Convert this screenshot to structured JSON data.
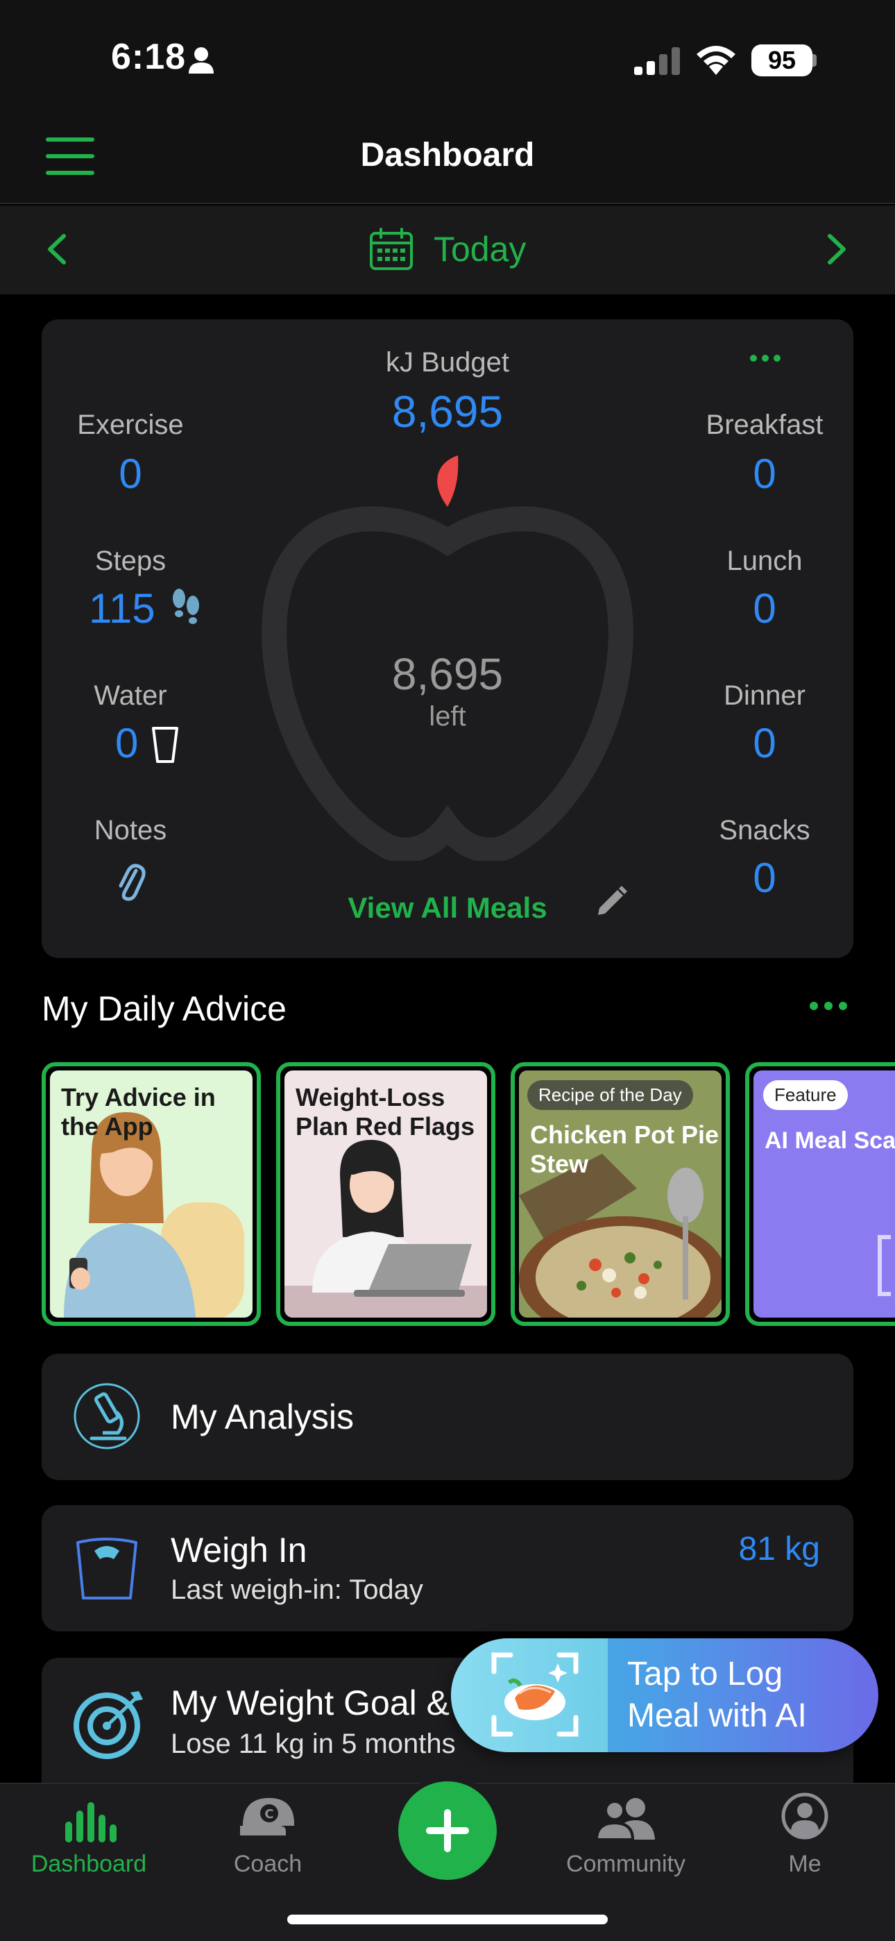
{
  "status": {
    "time": "6:18",
    "battery": "95"
  },
  "header": {
    "title": "Dashboard"
  },
  "date_nav": {
    "label": "Today"
  },
  "budget": {
    "title": "kJ Budget",
    "value": "8,695",
    "remaining_value": "8,695",
    "remaining_label": "left",
    "view_all": "View All Meals",
    "left_stats": [
      {
        "label": "Exercise",
        "value": "0"
      },
      {
        "label": "Steps",
        "value": "115"
      },
      {
        "label": "Water",
        "value": "0"
      },
      {
        "label": "Notes",
        "value": ""
      }
    ],
    "right_stats": [
      {
        "label": "Breakfast",
        "value": "0"
      },
      {
        "label": "Lunch",
        "value": "0"
      },
      {
        "label": "Dinner",
        "value": "0"
      },
      {
        "label": "Snacks",
        "value": "0"
      }
    ]
  },
  "advice": {
    "title": "My Daily Advice",
    "cards": [
      {
        "title": "Try Advice in the App"
      },
      {
        "title": "Weight-Loss Plan Red Flags"
      },
      {
        "badge": "Recipe of the Day",
        "title": "Chicken Pot Pie Stew"
      },
      {
        "badge": "Feature",
        "title": "AI Meal Sca"
      }
    ]
  },
  "analysis": {
    "title": "My Analysis"
  },
  "weigh_in": {
    "title": "Weigh In",
    "subtitle": "Last weigh-in: Today",
    "value": "81 kg"
  },
  "goal": {
    "title": "My Weight Goal &",
    "subtitle": "Lose 11 kg in 5 months"
  },
  "ai_log": {
    "line1": "Tap to Log",
    "line2": "Meal with AI"
  },
  "tabs": [
    {
      "label": "Dashboard",
      "active": true
    },
    {
      "label": "Coach"
    },
    {
      "label": "Community"
    },
    {
      "label": "Me"
    }
  ],
  "colors": {
    "accent": "#21b24b",
    "value_blue": "#2f8af5",
    "card": "#1c1c1e"
  },
  "icons": [
    "person-icon",
    "signal-icon",
    "wifi-icon",
    "battery-icon",
    "menu-icon",
    "chevron-left-icon",
    "calendar-icon",
    "chevron-right-icon",
    "more-icon",
    "apple-ring-icon",
    "footsteps-icon",
    "glass-icon",
    "paperclip-icon",
    "pencil-icon",
    "microscope-icon",
    "scale-icon",
    "target-icon",
    "ai-scan-icon",
    "dashboard-icon",
    "coach-icon",
    "plus-icon",
    "community-icon",
    "profile-icon"
  ]
}
